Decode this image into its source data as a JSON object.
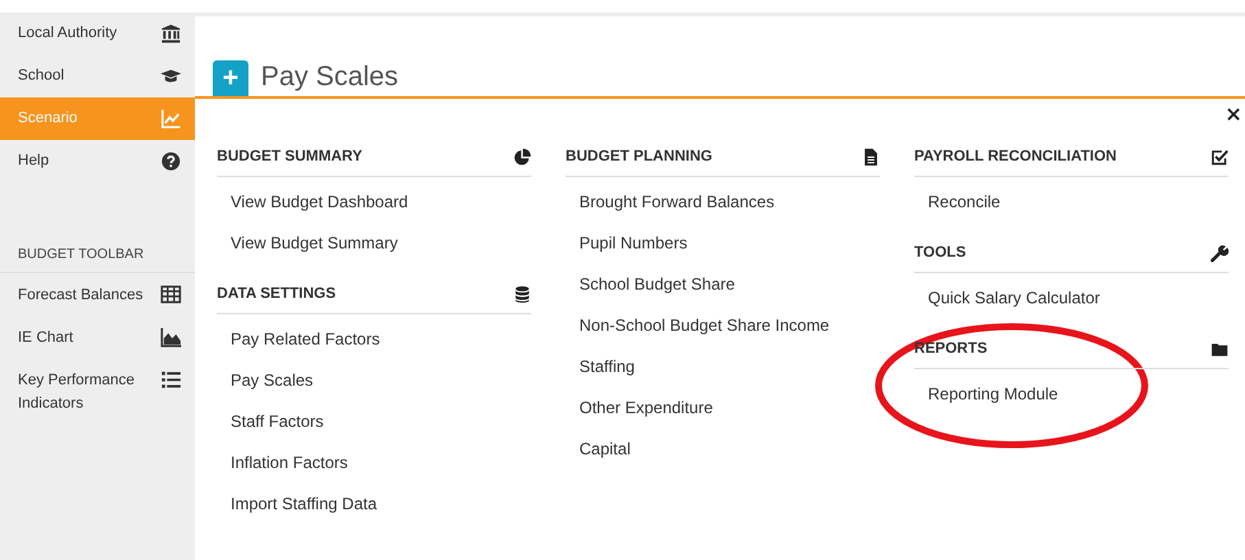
{
  "sidebar": {
    "items": [
      {
        "label": "Local Authority",
        "selected": false
      },
      {
        "label": "School",
        "selected": false
      },
      {
        "label": "Scenario",
        "selected": true
      },
      {
        "label": "Help",
        "selected": false
      }
    ],
    "toolbar_heading": "BUDGET TOOLBAR",
    "toolbar_items": [
      {
        "label": "Forecast Balances"
      },
      {
        "label": "IE Chart"
      },
      {
        "label": "Key Performance Indicators"
      }
    ]
  },
  "page": {
    "add_button": "+",
    "title": "Pay Scales",
    "close": "×"
  },
  "menu": {
    "columns": [
      [
        {
          "title": "BUDGET SUMMARY",
          "items": [
            "View Budget Dashboard",
            "View Budget Summary"
          ]
        },
        {
          "title": "DATA SETTINGS",
          "items": [
            "Pay Related Factors",
            "Pay Scales",
            "Staff Factors",
            "Inflation Factors",
            "Import Staffing Data"
          ]
        }
      ],
      [
        {
          "title": "BUDGET PLANNING",
          "items": [
            "Brought Forward Balances",
            "Pupil Numbers",
            "School Budget Share",
            "Non-School Budget Share Income",
            "Staffing",
            "Other Expenditure",
            "Capital"
          ]
        }
      ],
      [
        {
          "title": "PAYROLL RECONCILIATION",
          "items": [
            "Reconcile"
          ]
        },
        {
          "title": "TOOLS",
          "items": [
            "Quick Salary Calculator"
          ]
        },
        {
          "title": "REPORTS",
          "items": [
            "Reporting Module"
          ]
        }
      ]
    ]
  }
}
